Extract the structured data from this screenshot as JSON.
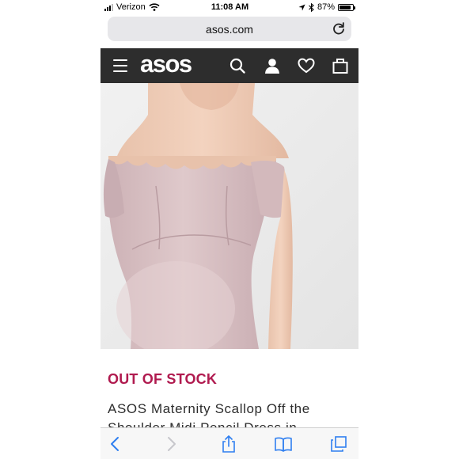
{
  "status_bar": {
    "carrier": "Verizon",
    "time": "11:08 AM",
    "battery_percent": "87%",
    "battery_level": 0.87,
    "icons": [
      "signal-icon",
      "wifi-icon",
      "location-arrow-icon",
      "bluetooth-icon",
      "battery-icon"
    ]
  },
  "browser": {
    "url": "asos.com",
    "icons": [
      "reload-icon",
      "back-icon",
      "forward-icon",
      "share-icon",
      "bookmarks-icon",
      "tabs-icon"
    ]
  },
  "site_header": {
    "logo": "asos",
    "icons": [
      "hamburger-menu-icon",
      "search-icon",
      "account-icon",
      "wishlist-heart-icon",
      "shopping-bag-icon"
    ],
    "background_color": "#2d2d2d"
  },
  "product": {
    "stock_status": "OUT OF STOCK",
    "stock_status_color": "#b01a4f",
    "name": "ASOS Maternity Scallop Off the Shoulder Midi Pencil Dress in"
  }
}
